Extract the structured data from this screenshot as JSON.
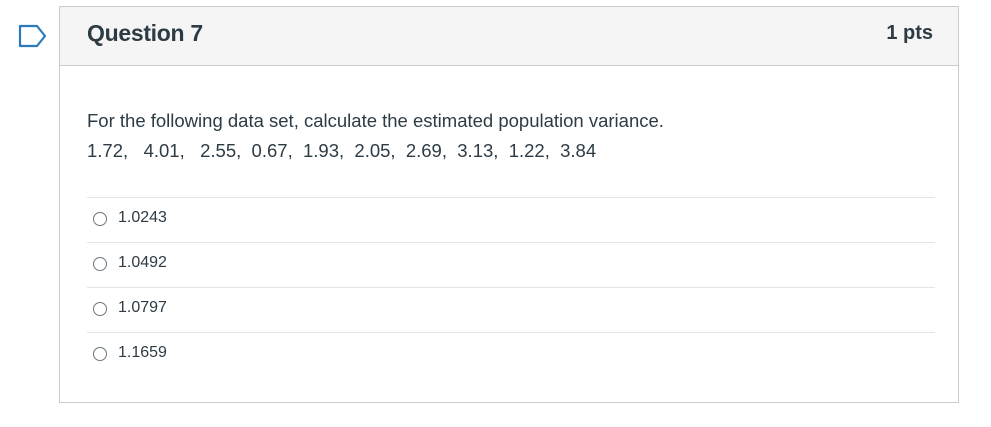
{
  "question": {
    "title": "Question 7",
    "points": "1 pts",
    "text_line1": "For the following data set, calculate the estimated population variance.",
    "text_line2": "1.72,   4.01,   2.55,  0.67,  1.93,  2.05,  2.69,  3.13,  1.22,  3.84"
  },
  "answers": [
    {
      "label": "1.0243"
    },
    {
      "label": "1.0492"
    },
    {
      "label": "1.0797"
    },
    {
      "label": "1.1659"
    }
  ],
  "colors": {
    "accent": "#2b7abc",
    "text": "#2d3b45",
    "border": "#c7cdd1",
    "header_bg": "#f5f5f5"
  },
  "icons": {
    "flag": "bookmark-flag-icon"
  }
}
